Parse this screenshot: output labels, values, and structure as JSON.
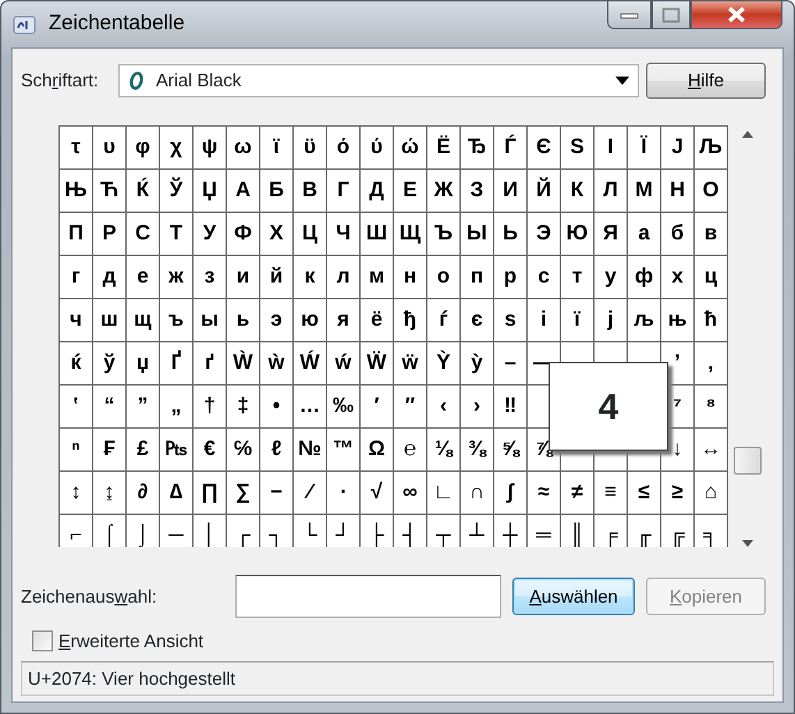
{
  "window": {
    "title": "Zeichentabelle"
  },
  "font": {
    "label": {
      "before": "Sch",
      "key": "r",
      "after": "iftart:"
    },
    "value": "Arial Black"
  },
  "help_button": {
    "key": "H",
    "after": "ilfe"
  },
  "grid": {
    "rows": [
      [
        "τ",
        "υ",
        "φ",
        "χ",
        "ψ",
        "ω",
        "ϊ",
        "ϋ",
        "ό",
        "ύ",
        "ώ",
        "Ё",
        "Ђ",
        "Ѓ",
        "Є",
        "Ѕ",
        "І",
        "Ї",
        "Ј",
        "Љ"
      ],
      [
        "Њ",
        "Ћ",
        "Ќ",
        "Ў",
        "Џ",
        "А",
        "Б",
        "В",
        "Г",
        "Д",
        "Е",
        "Ж",
        "З",
        "И",
        "Й",
        "К",
        "Л",
        "М",
        "Н",
        "О"
      ],
      [
        "П",
        "Р",
        "С",
        "Т",
        "У",
        "Ф",
        "Х",
        "Ц",
        "Ч",
        "Ш",
        "Щ",
        "Ъ",
        "Ы",
        "Ь",
        "Э",
        "Ю",
        "Я",
        "а",
        "б",
        "в"
      ],
      [
        "г",
        "д",
        "е",
        "ж",
        "з",
        "и",
        "й",
        "к",
        "л",
        "м",
        "н",
        "о",
        "п",
        "р",
        "с",
        "т",
        "у",
        "ф",
        "х",
        "ц"
      ],
      [
        "ч",
        "ш",
        "щ",
        "ъ",
        "ы",
        "ь",
        "э",
        "ю",
        "я",
        "ё",
        "ђ",
        "ѓ",
        "є",
        "ѕ",
        "і",
        "ї",
        "ј",
        "љ",
        "њ",
        "ћ"
      ],
      [
        "ќ",
        "ў",
        "џ",
        "Ґ",
        "ґ",
        "Ẁ",
        "ẁ",
        "Ẃ",
        "ẃ",
        "Ẅ",
        "ẅ",
        "Ỳ",
        "ỳ",
        "–",
        "—",
        null,
        null,
        null,
        "’",
        "‚"
      ],
      [
        "‛",
        "“",
        "”",
        "„",
        "†",
        "‡",
        "•",
        "…",
        "‰",
        "′",
        "″",
        "‹",
        "›",
        "‼",
        null,
        null,
        null,
        null,
        "⁷",
        "⁸"
      ],
      [
        "ⁿ",
        "₣",
        "£",
        "₧",
        "€",
        "℅",
        "ℓ",
        "№",
        "™",
        "Ω",
        "℮",
        "⅛",
        "⅜",
        "⅝",
        "⅞",
        null,
        null,
        null,
        "↓",
        "↔"
      ],
      [
        "↕",
        "↨",
        "∂",
        "∆",
        "∏",
        "∑",
        "−",
        "∕",
        "∙",
        "√",
        "∞",
        "∟",
        "∩",
        "∫",
        "≈",
        "≠",
        "≡",
        "≤",
        "≥",
        "⌂"
      ],
      [
        "⌐",
        "⌠",
        "⌡",
        "─",
        "│",
        "┌",
        "┐",
        "└",
        "┘",
        "├",
        "┤",
        "┬",
        "┴",
        "┼",
        "═",
        "║",
        "╒",
        "╓",
        "╔",
        "╕"
      ]
    ],
    "magnified": "4"
  },
  "selection": {
    "label": {
      "before": "Zeichenaus",
      "key": "w",
      "after": "ahl:"
    }
  },
  "buttons": [
    {
      "key": "A",
      "after": "uswählen",
      "default": true,
      "disabled": false
    },
    {
      "key": "K",
      "after": "opieren",
      "default": false,
      "disabled": true
    }
  ],
  "advanced": {
    "label": {
      "key": "E",
      "after": "rweiterte Ansicht"
    },
    "checked": false
  },
  "status_bar": "U+2074: Vier hochgestellt"
}
